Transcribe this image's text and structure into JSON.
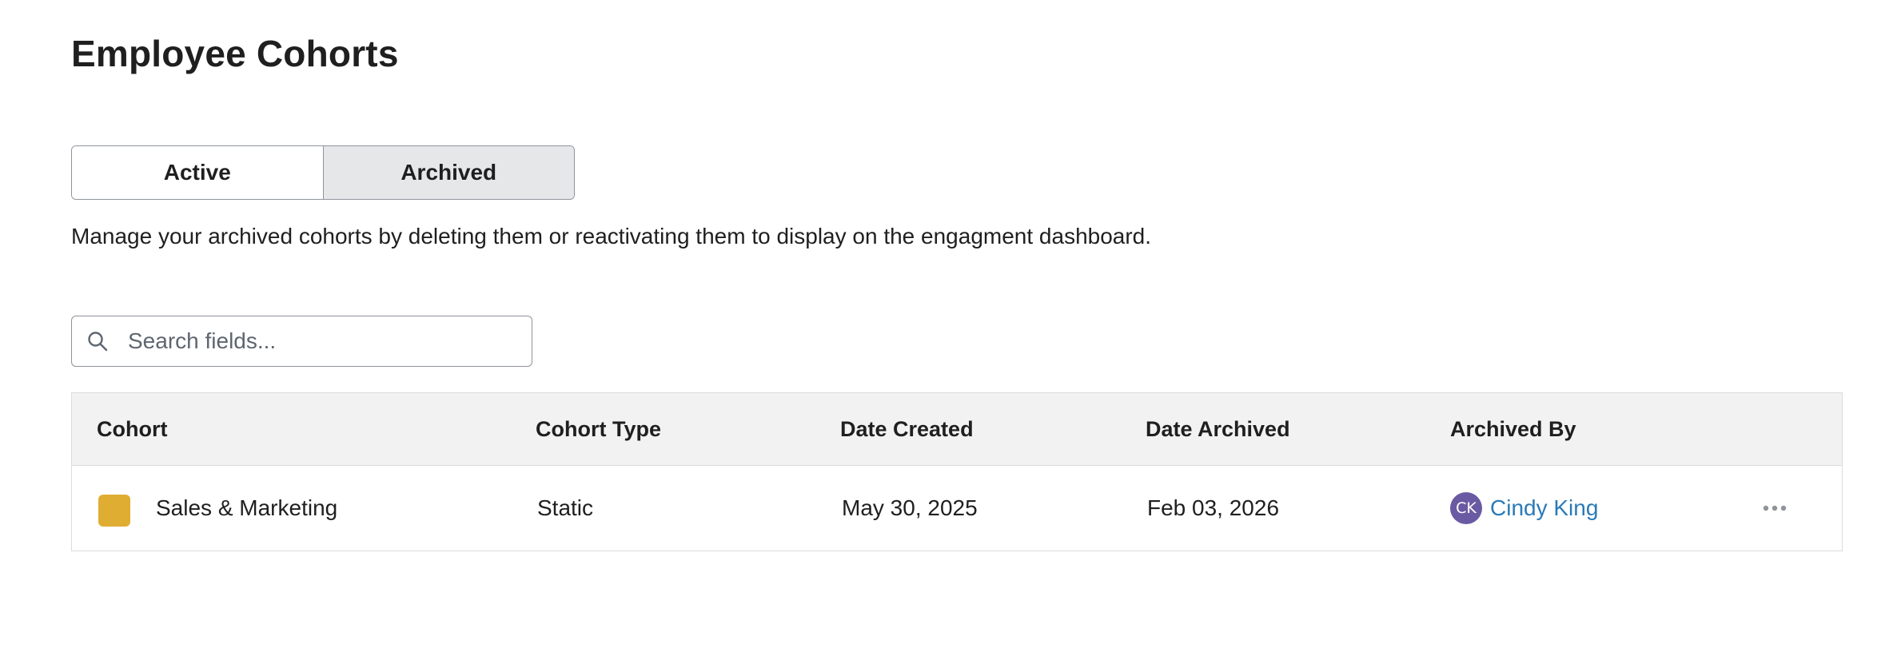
{
  "page": {
    "title": "Employee Cohorts",
    "description": "Manage your archived cohorts by deleting them or reactivating them to display on the engagment dashboard."
  },
  "tabs": [
    {
      "label": "Active",
      "selected": false
    },
    {
      "label": "Archived",
      "selected": true
    }
  ],
  "search": {
    "placeholder": "Search fields...",
    "value": "",
    "icon": "search-icon"
  },
  "table": {
    "headers": {
      "cohort": "Cohort",
      "cohort_type": "Cohort Type",
      "date_created": "Date Created",
      "date_archived": "Date Archived",
      "archived_by": "Archived By"
    },
    "rows": [
      {
        "swatch_color": "#e0ad33",
        "cohort": "Sales & Marketing",
        "cohort_type": "Static",
        "date_created": "May 30, 2025",
        "date_archived": "Feb 03, 2026",
        "archived_by": {
          "initials": "CK",
          "name": "Cindy King",
          "avatar_color": "#6a5aa3"
        },
        "actions_icon": "more-horizontal-icon"
      }
    ]
  },
  "colors": {
    "link": "#2a7ab8",
    "selected_tab_bg": "#e6e7e9",
    "header_bg": "#f2f2f2"
  }
}
